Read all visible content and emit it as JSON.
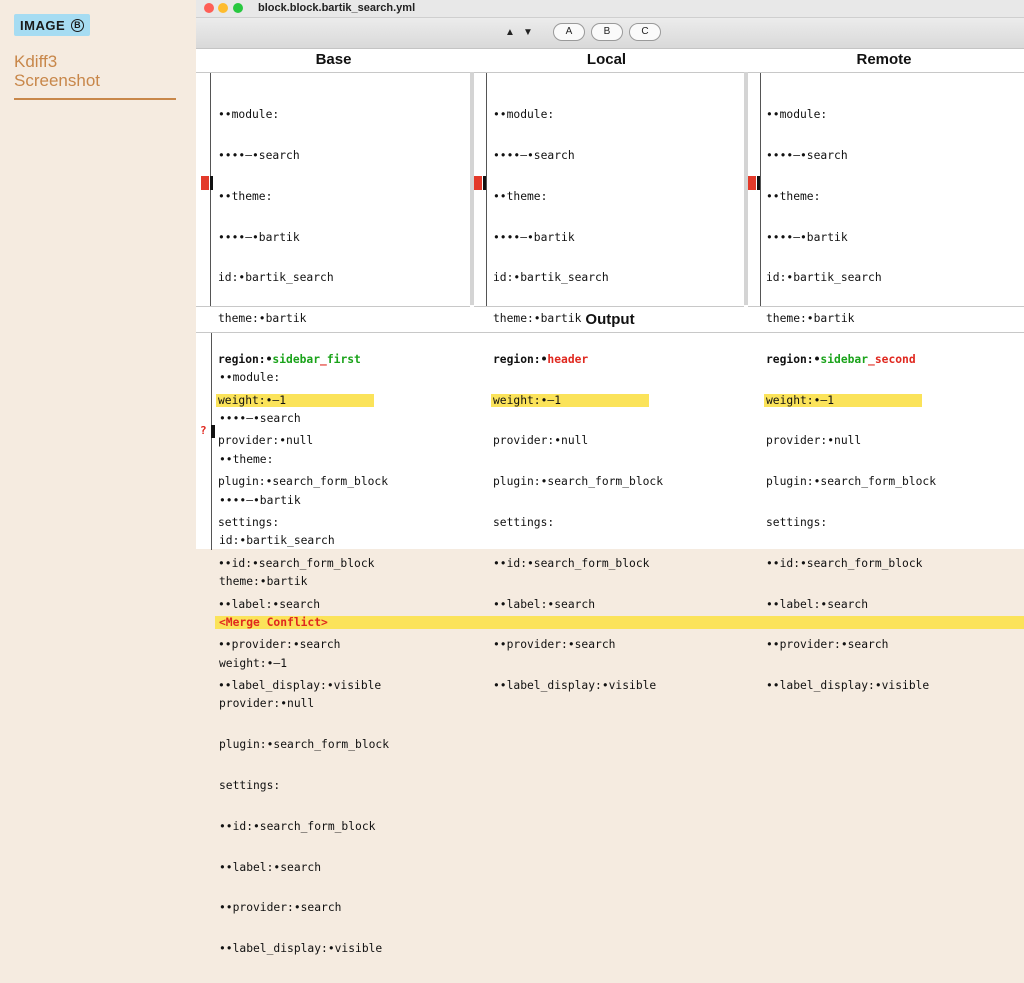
{
  "sidebar": {
    "badge": "IMAGE",
    "badge_letter": "B",
    "title_line1": "Kdiff3",
    "title_line2": "Screenshot"
  },
  "window": {
    "title": "block.block.bartik_search.yml"
  },
  "toolbar": {
    "up_arrow": "▲",
    "down_arrow": "▼",
    "btn_a": "A",
    "btn_b": "B",
    "btn_c": "C"
  },
  "panes": {
    "base": {
      "header": "Base",
      "lines": [
        "••module:",
        "••••–•search",
        "••theme:",
        "••••–•bartik",
        "id:•bartik_search",
        "theme:•bartik"
      ],
      "region_label": "region:•",
      "region_word1": "sidebar",
      "region_underscore": "_",
      "region_word2": "first",
      "weight_line": "weight:•–1",
      "rest": [
        "provider:•null",
        "plugin:•search_form_block",
        "settings:",
        "••id:•search_form_block",
        "••label:•search",
        "••provider:•search",
        "••label_display:•visible"
      ]
    },
    "local": {
      "header": "Local",
      "lines": [
        "••module:",
        "••••–•search",
        "••theme:",
        "••••–•bartik",
        "id:•bartik_search",
        "theme:•bartik"
      ],
      "region_label": "region:•",
      "region_value": "header",
      "weight_line": "weight:•–1",
      "rest": [
        "provider:•null",
        "plugin:•search_form_block",
        "settings:",
        "••id:•search_form_block",
        "••label:•search",
        "••provider:•search",
        "••label_display:•visible"
      ]
    },
    "remote": {
      "header": "Remote",
      "lines": [
        "••module:",
        "••••–•search",
        "••theme:",
        "••••–•bartik",
        "id:•bartik_search",
        "theme:•bartik"
      ],
      "region_label": "region:•",
      "region_word1": "sidebar",
      "region_underscore": "_",
      "region_word2": "second",
      "weight_line": "weight:•–1",
      "rest": [
        "provider:•null",
        "plugin:•search_form_block",
        "settings:",
        "••id:•search_form_block",
        "••label:•search",
        "••provider:•search",
        "••label_display:•visible"
      ]
    }
  },
  "output": {
    "header": "Output",
    "lines_before": [
      "••module:",
      "••••–•search",
      "••theme:",
      "••••–•bartik",
      "id:•bartik_search",
      "theme:•bartik"
    ],
    "conflict_marker": "?",
    "conflict_text": "<Merge Conflict>",
    "lines_after": [
      "weight:•–1",
      "provider:•null",
      "plugin:•search_form_block",
      "settings:",
      "••id:•search_form_block",
      "••label:•search",
      "••provider:•search",
      "••label_display:•visible"
    ]
  },
  "colors": {
    "highlight": "#fbe35a",
    "conflict_red": "#e0281f",
    "added_green": "#1aa31a",
    "sidebar_bg": "#f5ebe0",
    "sidebar_accent": "#c8874a"
  }
}
